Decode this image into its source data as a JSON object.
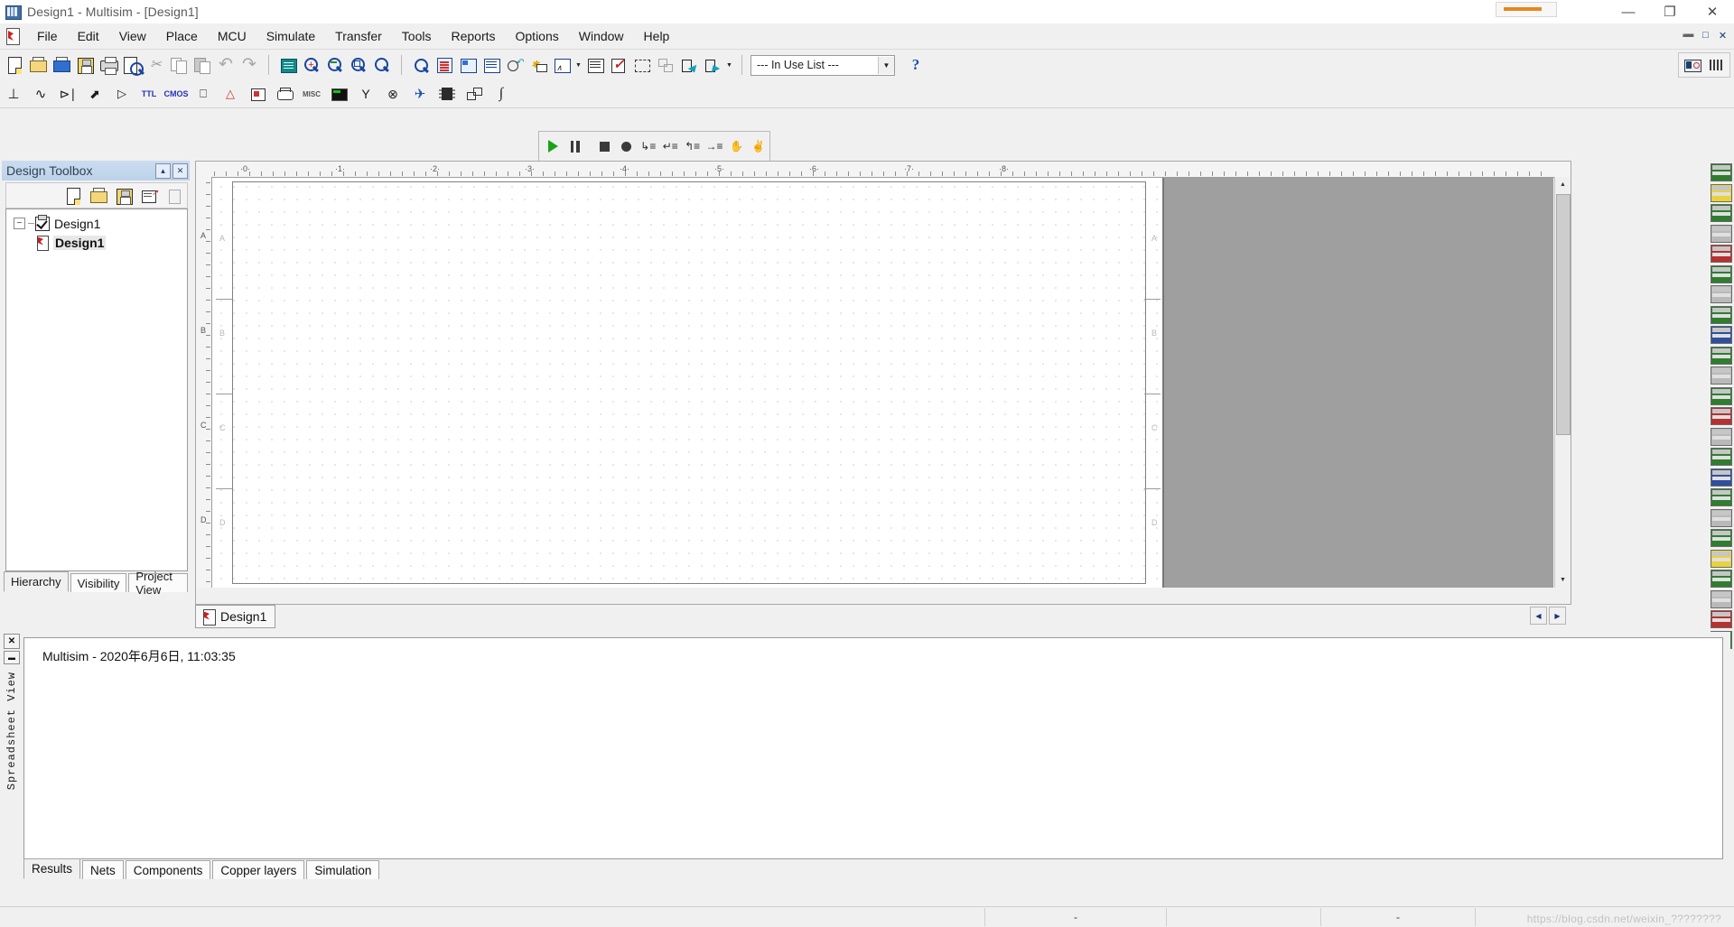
{
  "window": {
    "title": "Design1 - Multisim - [Design1]",
    "icon": "multisim-app-icon",
    "buttons": {
      "minimize": "—",
      "maximize": "❐",
      "close": "✕"
    },
    "mdi_buttons": {
      "restore_down": "➖",
      "maximize_child": "□",
      "close_child": "✕"
    }
  },
  "menu": {
    "icon": "schematic-doc-icon",
    "items": [
      {
        "label": "File",
        "mnemonic": "F"
      },
      {
        "label": "Edit",
        "mnemonic": "E"
      },
      {
        "label": "View",
        "mnemonic": "V"
      },
      {
        "label": "Place",
        "mnemonic": "P"
      },
      {
        "label": "MCU",
        "mnemonic": "M"
      },
      {
        "label": "Simulate",
        "mnemonic": "S"
      },
      {
        "label": "Transfer",
        "mnemonic": "a"
      },
      {
        "label": "Tools",
        "mnemonic": "T"
      },
      {
        "label": "Reports",
        "mnemonic": "R"
      },
      {
        "label": "Options",
        "mnemonic": "O"
      },
      {
        "label": "Window",
        "mnemonic": "W"
      },
      {
        "label": "Help",
        "mnemonic": "H"
      }
    ]
  },
  "toolbar_standard": {
    "groups": [
      {
        "buttons": [
          {
            "name": "new-file-icon",
            "tip": "New"
          },
          {
            "name": "open-file-icon",
            "tip": "Open"
          },
          {
            "name": "open-design-icon",
            "tip": "Open samples"
          },
          {
            "name": "save-icon",
            "tip": "Save"
          },
          {
            "name": "print-icon",
            "tip": "Print"
          },
          {
            "name": "print-preview-icon",
            "tip": "Print preview"
          },
          {
            "name": "cut-icon",
            "tip": "Cut"
          },
          {
            "name": "copy-icon",
            "tip": "Copy"
          },
          {
            "name": "paste-icon",
            "tip": "Paste"
          },
          {
            "name": "undo-icon",
            "tip": "Undo"
          },
          {
            "name": "redo-icon",
            "tip": "Redo"
          }
        ]
      },
      {
        "buttons": [
          {
            "name": "full-screen-icon",
            "tip": "Toggle full screen"
          },
          {
            "name": "zoom-in-icon",
            "tip": "Zoom in"
          },
          {
            "name": "zoom-out-icon",
            "tip": "Zoom out"
          },
          {
            "name": "zoom-area-icon",
            "tip": "Zoom area"
          },
          {
            "name": "zoom-fit-icon",
            "tip": "Zoom fit to page"
          }
        ]
      },
      {
        "buttons": [
          {
            "name": "zoom-selection-icon",
            "tip": "Zoom selection"
          },
          {
            "name": "design-toolbox-icon",
            "tip": "Show design toolbox"
          },
          {
            "name": "spreadsheet-view-icon",
            "tip": "Show spreadsheet view"
          },
          {
            "name": "database-manager-icon",
            "tip": "Database manager"
          },
          {
            "name": "create-component-icon",
            "tip": "Create component"
          },
          {
            "name": "grapher-icon",
            "tip": "Grapher / analyses"
          },
          {
            "name": "postprocessor-icon",
            "tip": "Postprocessor"
          },
          {
            "name": "erc-icon",
            "tip": "Electrical rules check"
          },
          {
            "name": "area-capture-icon",
            "tip": "Capture screen area"
          },
          {
            "name": "back-annotate-icon",
            "tip": "Back annotate from Ultiboard"
          },
          {
            "name": "forward-annotate-icon",
            "tip": "Forward annotate to Ultiboard"
          },
          {
            "name": "transfer-dropdown-icon",
            "tip": "Transfer options"
          }
        ]
      }
    ],
    "in_use_list": {
      "label": "--- In Use List ---",
      "arrow": "▼"
    },
    "help_button": {
      "name": "help-icon",
      "label": "?"
    },
    "right_group": [
      {
        "name": "instruments-panel-icon"
      },
      {
        "name": "list-view-icon"
      }
    ]
  },
  "toolbar_components": {
    "buttons": [
      {
        "name": "place-source-icon",
        "glyph": "⊥"
      },
      {
        "name": "place-basic-icon",
        "glyph": "∿"
      },
      {
        "name": "place-diode-icon",
        "glyph": "⊲|"
      },
      {
        "name": "place-transistor-icon",
        "glyph": "↖"
      },
      {
        "name": "place-analog-icon",
        "glyph": "▷"
      },
      {
        "name": "place-ttl-icon",
        "glyph": "TTL"
      },
      {
        "name": "place-cmos-icon",
        "glyph": "CMOS"
      },
      {
        "name": "place-misc-digital-icon",
        "glyph": "⎓"
      },
      {
        "name": "place-mixed-icon",
        "glyph": "△"
      },
      {
        "name": "place-indicator-icon",
        "glyph": "▣"
      },
      {
        "name": "place-power-icon",
        "glyph": "⏚"
      },
      {
        "name": "place-misc-icon",
        "glyph": "MISC"
      },
      {
        "name": "place-advanced-peripherals-icon",
        "glyph": "█"
      },
      {
        "name": "place-rf-icon",
        "glyph": "Υ"
      },
      {
        "name": "place-electromechanical-icon",
        "glyph": "⊗"
      },
      {
        "name": "place-nipl-icon",
        "glyph": "✈"
      },
      {
        "name": "place-mcu-icon",
        "glyph": "☷"
      },
      {
        "name": "place-hierarchical-block-icon",
        "glyph": "❐"
      },
      {
        "name": "place-bus-icon",
        "glyph": "∫"
      }
    ]
  },
  "toolbar_simulation": {
    "buttons": [
      {
        "name": "run-button",
        "tip": "Run"
      },
      {
        "name": "pause-button",
        "tip": "Pause"
      },
      {
        "name": "stop-button",
        "tip": "Stop"
      },
      {
        "name": "record-button",
        "tip": "Record"
      },
      {
        "name": "step-into-button",
        "tip": "Step into"
      },
      {
        "name": "step-over-button",
        "tip": "Step over"
      },
      {
        "name": "step-out-button",
        "tip": "Step out"
      },
      {
        "name": "run-to-cursor-button",
        "tip": "Run to cursor"
      },
      {
        "name": "toggle-breakpoint-button",
        "tip": "Toggle breakpoint"
      },
      {
        "name": "remove-breakpoints-button",
        "tip": "Remove all breakpoints"
      }
    ]
  },
  "design_toolbox": {
    "title": "Design Toolbox",
    "header_buttons": [
      {
        "name": "collapse-panel-button",
        "glyph": "▴"
      },
      {
        "name": "close-panel-button",
        "glyph": "✕"
      }
    ],
    "tool_buttons": [
      {
        "name": "new-design-icon"
      },
      {
        "name": "open-design-icon"
      },
      {
        "name": "save-design-icon"
      },
      {
        "name": "new-sheet-icon"
      },
      {
        "name": "delete-sheet-icon"
      }
    ],
    "tree": {
      "root": {
        "label": "Design1",
        "checked": true,
        "expander": "−"
      },
      "child": {
        "label": "Design1"
      }
    },
    "tabs": [
      {
        "label": "Hierarchy",
        "active": true
      },
      {
        "label": "Visibility",
        "active": false
      },
      {
        "label": "Project View",
        "active": false
      }
    ]
  },
  "canvas": {
    "ruler_h_labels": [
      "0",
      "1",
      "2",
      "3",
      "4",
      "5",
      "6",
      "7",
      "8"
    ],
    "zone_labels_v": [
      "A",
      "B",
      "C",
      "D"
    ],
    "scroll": {
      "up": "▲",
      "down": "▼"
    }
  },
  "document_tabs": [
    {
      "label": "Design1",
      "active": true
    }
  ],
  "document_tab_nav": [
    {
      "name": "prev-tab-button",
      "glyph": "◀"
    },
    {
      "name": "next-tab-button",
      "glyph": "▶"
    }
  ],
  "spreadsheet_view": {
    "side_label": "Spreadsheet View",
    "close_glyph": "✕",
    "pin_glyph": "▬",
    "content_line": "Multisim  -  2020年6月6日, 11:03:35",
    "tabs": [
      {
        "label": "Results",
        "active": true
      },
      {
        "label": "Nets",
        "active": false
      },
      {
        "label": "Components",
        "active": false
      },
      {
        "label": "Copper layers",
        "active": false
      },
      {
        "label": "Simulation",
        "active": false
      }
    ]
  },
  "status_bar": {
    "cells": [
      "",
      "-",
      "",
      "-",
      ""
    ],
    "watermark": "https://blog.csdn.net/weixin_????????"
  },
  "colors": {
    "accent_blue": "#1b50b4",
    "title_panel": "#c2d6ee",
    "run_green": "#19a319",
    "canvas_gray": "#9f9f9f",
    "chrome": "#f0f0f0"
  }
}
